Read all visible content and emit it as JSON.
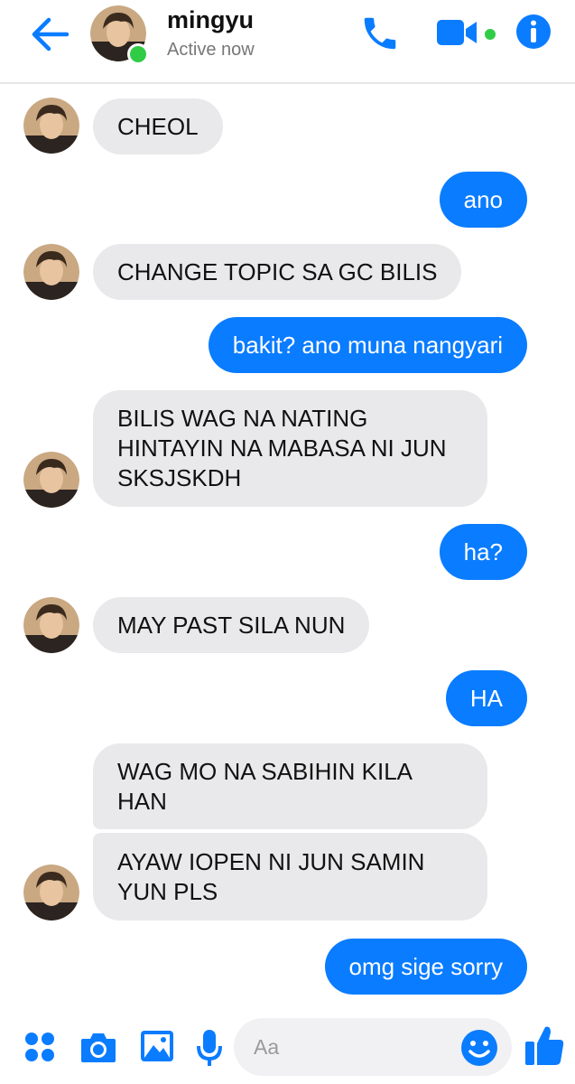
{
  "header": {
    "back_icon": "back-arrow-icon",
    "contact_name": "mingyu",
    "status": "Active now",
    "accent_color": "#0a7cff",
    "online_color": "#31cc46"
  },
  "messages": [
    {
      "side": "in",
      "text": "CHEOL",
      "avatar": true
    },
    {
      "side": "out",
      "text": "ano"
    },
    {
      "side": "in",
      "text": "CHANGE TOPIC SA GC BILIS",
      "avatar": true
    },
    {
      "side": "out",
      "text": "bakit? ano muna nangyari"
    },
    {
      "side": "in",
      "text": "BILIS WAG NA NATING HINTAYIN NA MABASA NI JUN SKSJSKDH",
      "avatar": true
    },
    {
      "side": "out",
      "text": "ha?"
    },
    {
      "side": "in",
      "text": "MAY PAST SILA NUN",
      "avatar": true
    },
    {
      "side": "out",
      "text": "HA"
    },
    {
      "side": "in",
      "text": "WAG MO NA SABIHIN KILA HAN",
      "avatar": false
    },
    {
      "side": "in",
      "text": "AYAW IOPEN NI JUN SAMIN YUN PLS",
      "avatar": true
    },
    {
      "side": "out",
      "text": "omg sige sorry"
    }
  ],
  "composer": {
    "placeholder": "Aa",
    "icons": [
      "apps-icon",
      "camera-icon",
      "gallery-icon",
      "microphone-icon",
      "emoji-icon",
      "like-thumb-icon"
    ]
  },
  "colors": {
    "incoming_bubble": "#e9e9eb",
    "outgoing_bubble": "#0a7cff"
  }
}
